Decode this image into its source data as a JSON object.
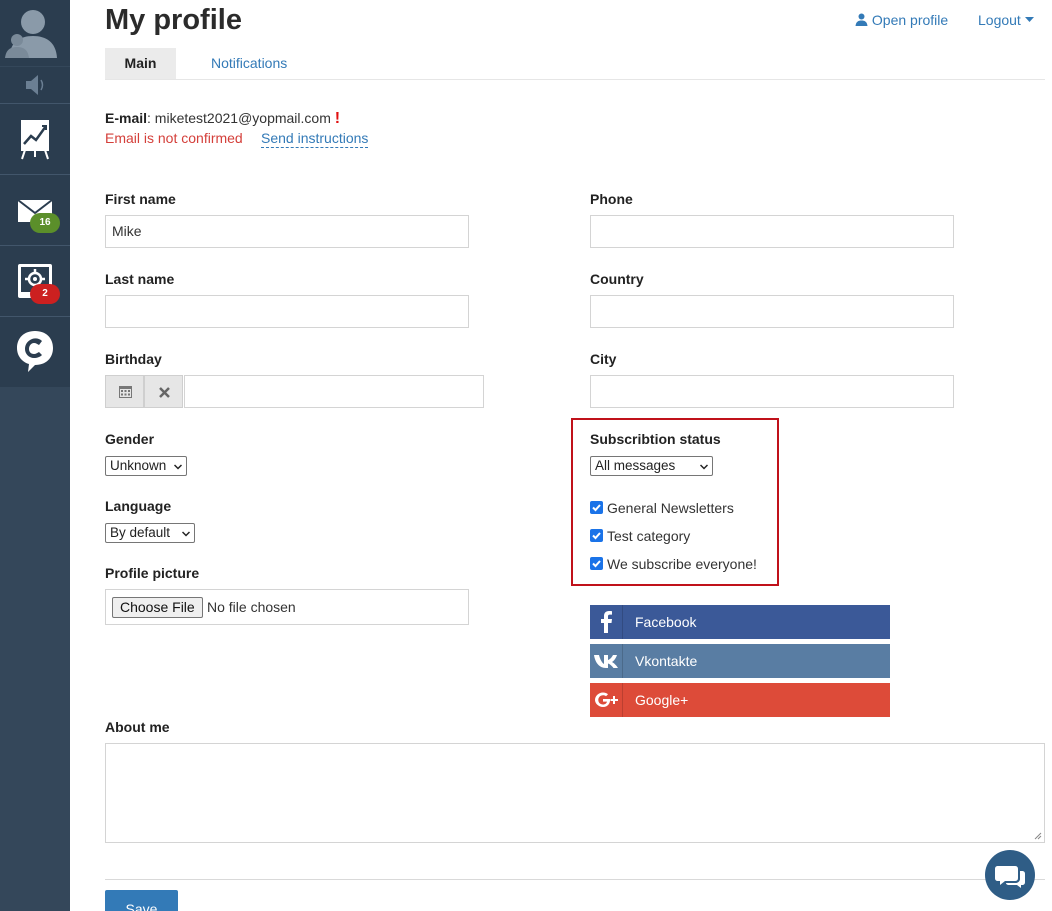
{
  "page": {
    "title": "My profile"
  },
  "header": {
    "open_profile": "Open profile",
    "logout": "Logout"
  },
  "tabs": [
    {
      "label": "Main",
      "active": true
    },
    {
      "label": "Notifications",
      "active": false
    }
  ],
  "sidebar": {
    "items": [
      {
        "icon": "avatar-icon"
      },
      {
        "icon": "mute-icon"
      },
      {
        "icon": "chart-presentation-icon"
      },
      {
        "icon": "mail-icon",
        "badge": "16",
        "badge_color": "#5b8f2a"
      },
      {
        "icon": "settings-page-icon",
        "badge": "2",
        "badge_color": "#cc2020"
      },
      {
        "icon": "chat-logo-icon"
      }
    ]
  },
  "email": {
    "label": "E-mail",
    "value": "miketest2021@yopmail.com",
    "warning_mark": "!",
    "not_confirmed": "Email is not confirmed",
    "send_instructions": "Send instructions"
  },
  "form": {
    "first_name": {
      "label": "First name",
      "value": "Mike"
    },
    "last_name": {
      "label": "Last name",
      "value": ""
    },
    "birthday": {
      "label": "Birthday",
      "value": ""
    },
    "gender": {
      "label": "Gender",
      "value": "Unknown"
    },
    "language": {
      "label": "Language",
      "value": "By default"
    },
    "profile_picture": {
      "label": "Profile picture",
      "button": "Choose File",
      "status": "No file chosen"
    },
    "phone": {
      "label": "Phone",
      "value": ""
    },
    "country": {
      "label": "Country",
      "value": ""
    },
    "city": {
      "label": "City",
      "value": ""
    },
    "about": {
      "label": "About me",
      "value": ""
    }
  },
  "subscription": {
    "label": "Subscribtion status",
    "value": "All messages",
    "categories": [
      {
        "label": "General Newsletters",
        "checked": true
      },
      {
        "label": "Test category",
        "checked": true
      },
      {
        "label": "We subscribe everyone!",
        "checked": true
      }
    ]
  },
  "social": [
    {
      "label": "Facebook",
      "color": "#3b5998",
      "icon": "facebook-icon"
    },
    {
      "label": "Vkontakte",
      "color": "#597da3",
      "icon": "vk-icon"
    },
    {
      "label": "Google+",
      "color": "#dd4b39",
      "icon": "google-plus-icon"
    }
  ],
  "actions": {
    "save": "Save"
  }
}
